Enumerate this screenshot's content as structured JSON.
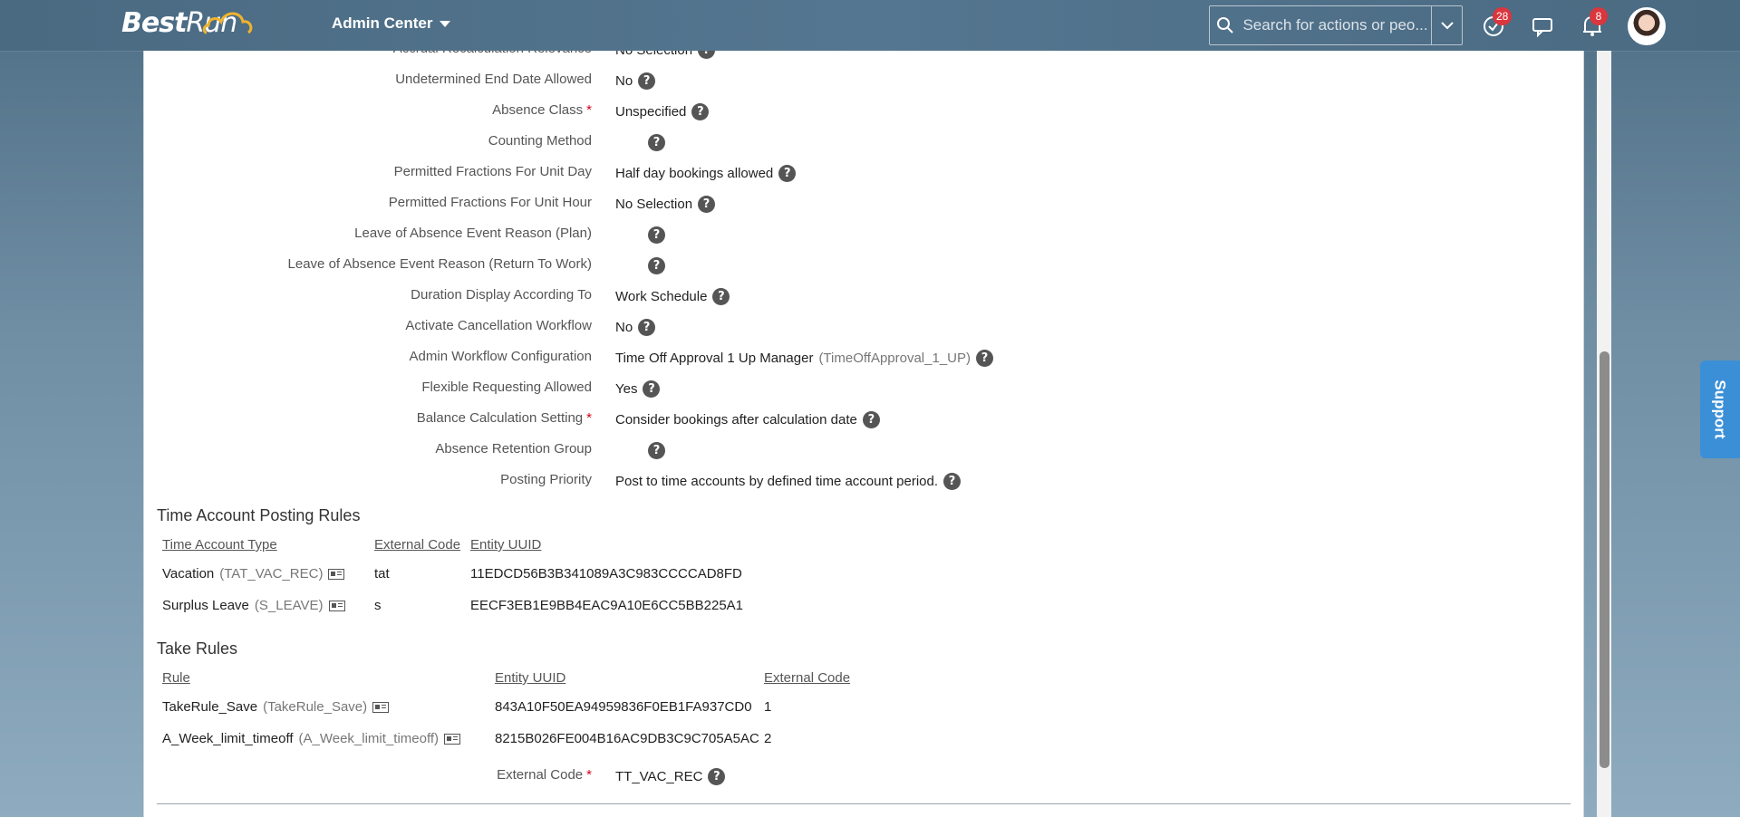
{
  "header": {
    "logo_bold": "Best",
    "logo_light": "Run",
    "module": "Admin Center",
    "search_placeholder": "Search for actions or peo...",
    "todo_badge": "28",
    "notifications_badge": "8"
  },
  "fields": [
    {
      "label": "Accrual Recalculation Relevance",
      "value": "No Selection",
      "required": false
    },
    {
      "label": "Undetermined End Date Allowed",
      "value": "No",
      "required": false
    },
    {
      "label": "Absence Class",
      "value": "Unspecified",
      "required": true
    },
    {
      "label": "Counting Method",
      "value": "",
      "required": false
    },
    {
      "label": "Permitted Fractions For Unit Day",
      "value": "Half day bookings allowed",
      "required": false
    },
    {
      "label": "Permitted Fractions For Unit Hour",
      "value": "No Selection",
      "required": false
    },
    {
      "label": "Leave of Absence Event Reason (Plan)",
      "value": "",
      "required": false
    },
    {
      "label": "Leave of Absence Event Reason (Return To Work)",
      "value": "",
      "required": false
    },
    {
      "label": "Duration Display According To",
      "value": "Work Schedule",
      "required": false
    },
    {
      "label": "Activate Cancellation Workflow",
      "value": "No",
      "required": false
    },
    {
      "label": "Admin Workflow Configuration",
      "value": "Time Off Approval 1 Up Manager",
      "code": "(TimeOffApproval_1_UP)",
      "required": false
    },
    {
      "label": "Flexible Requesting Allowed",
      "value": "Yes",
      "required": false
    },
    {
      "label": "Balance Calculation Setting",
      "value": "Consider bookings after calculation date",
      "required": true
    },
    {
      "label": "Absence Retention Group",
      "value": "",
      "required": false
    },
    {
      "label": "Posting Priority",
      "value": "Post to time accounts by defined time account period.",
      "required": false
    }
  ],
  "posting_rules": {
    "title": "Time Account Posting Rules",
    "headers": [
      "Time Account Type",
      "External Code",
      "Entity UUID"
    ],
    "rows": [
      {
        "name": "Vacation",
        "code": "(TAT_VAC_REC)",
        "external_code": "tat",
        "uuid": "11EDCD56B3B341089A3C983CCCCAD8FD"
      },
      {
        "name": "Surplus Leave",
        "code": "(S_LEAVE)",
        "external_code": "s",
        "uuid": "EECF3EB1E9BB4EAC9A10E6CC5BB225A1"
      }
    ]
  },
  "take_rules": {
    "title": "Take Rules",
    "headers": [
      "Rule",
      "Entity UUID",
      "External Code"
    ],
    "rows": [
      {
        "name": "TakeRule_Save",
        "code": "(TakeRule_Save)",
        "uuid": "843A10F50EA94959836F0EB1FA937CD0",
        "external_code": "1"
      },
      {
        "name": "A_Week_limit_timeoff",
        "code": "(A_Week_limit_timeoff)",
        "uuid": "8215B026FE004B16AC9DB3C9C705A5AC",
        "external_code": "2"
      }
    ]
  },
  "external_code_field": {
    "label": "External Code",
    "value": "TT_VAC_REC",
    "required": true
  },
  "support_label": "Support",
  "colors": {
    "accent": "#3b8fd6",
    "required": "#d0021b",
    "badge": "#d9363e"
  }
}
